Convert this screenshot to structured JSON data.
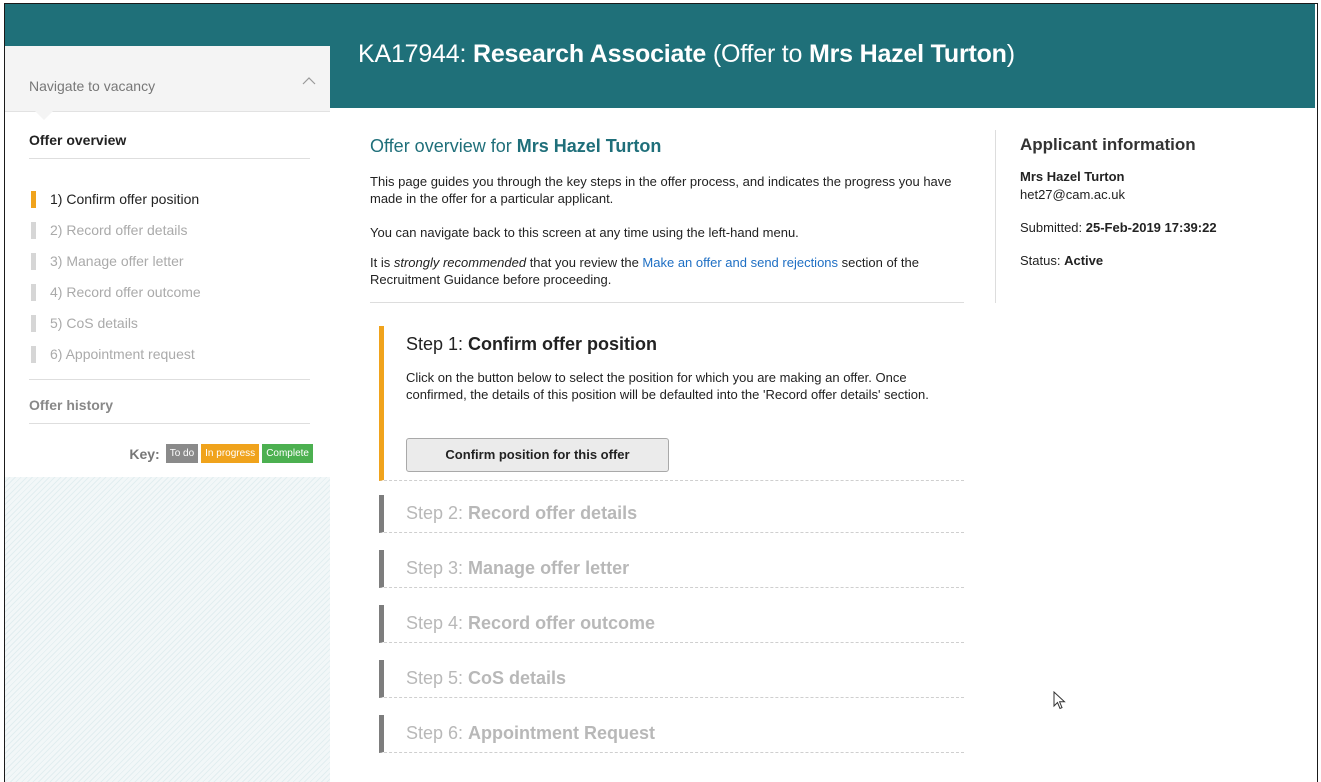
{
  "header": {
    "ref": "KA17944: ",
    "job_title": "Research Associate",
    "offer_prefix": " (Offer to ",
    "applicant": "Mrs Hazel Turton",
    "offer_suffix": ")"
  },
  "sidebar": {
    "navigate_label": "Navigate to vacancy",
    "overview_title": "Offer overview",
    "steps": [
      {
        "label": "1) Confirm offer position",
        "state": "active"
      },
      {
        "label": "2) Record offer details",
        "state": "todo"
      },
      {
        "label": "3) Manage offer letter",
        "state": "todo"
      },
      {
        "label": "4) Record offer outcome",
        "state": "todo"
      },
      {
        "label": "5) CoS details",
        "state": "todo"
      },
      {
        "label": "6) Appointment request",
        "state": "todo"
      }
    ],
    "history_title": "Offer history",
    "key": {
      "label": "Key:",
      "todo": "To do",
      "in_progress": "In progress",
      "complete": "Complete",
      "colors": {
        "todo": "#8a8a8a",
        "in_progress": "#f0a31c",
        "complete": "#4cb050"
      }
    }
  },
  "main": {
    "title_prefix": "Offer overview for ",
    "title_name": "Mrs Hazel Turton",
    "para1": "This page guides you through the key steps in the offer process, and indicates the progress you have made in the offer for a particular applicant.",
    "para2": "You can navigate back to this screen at any time using the left-hand menu.",
    "para3_a": "It is ",
    "para3_em": "strongly recommended",
    "para3_b": " that you review the ",
    "para3_link": "Make an offer and send rejections",
    "para3_c": " section of the Recruitment Guidance before proceeding.",
    "step1": {
      "prefix": "Step 1: ",
      "title": "Confirm offer position",
      "text": "Click on the button below to select the position for which you are making an offer. Once confirmed, the details of this position will be defaulted into the 'Record offer details' section.",
      "button": "Confirm position for this offer"
    },
    "steps": [
      {
        "prefix": "Step 2: ",
        "title": "Record offer details"
      },
      {
        "prefix": "Step 3: ",
        "title": "Manage offer letter"
      },
      {
        "prefix": "Step 4: ",
        "title": "Record offer outcome"
      },
      {
        "prefix": "Step 5: ",
        "title": "CoS details"
      },
      {
        "prefix": "Step 6: ",
        "title": "Appointment Request"
      }
    ]
  },
  "applicant": {
    "title": "Applicant information",
    "name": "Mrs Hazel Turton",
    "email": "het27@cam.ac.uk",
    "submitted_label": "Submitted: ",
    "submitted_value": "25-Feb-2019 17:39:22",
    "status_label": "Status: ",
    "status_value": "Active"
  },
  "colors": {
    "brand_teal": "#1f7079",
    "accent_orange": "#f0a31c",
    "link_blue": "#1e6fc4"
  }
}
